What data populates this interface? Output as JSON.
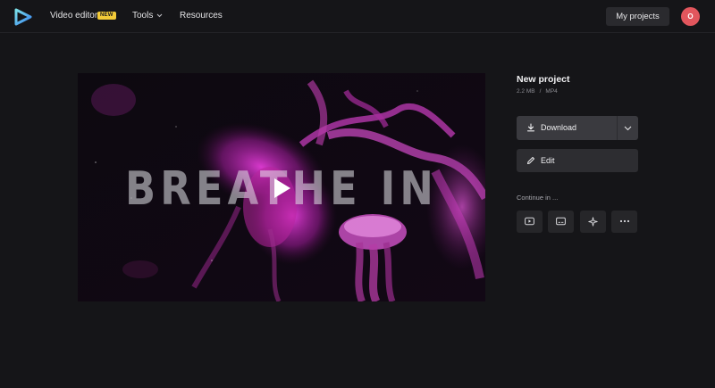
{
  "header": {
    "nav": {
      "video_editor": "Video editor",
      "video_editor_badge": "NEW",
      "tools": "Tools",
      "resources": "Resources"
    },
    "my_projects": "My projects",
    "avatar_initial": "O"
  },
  "video": {
    "overlay_text": "BREATHE IN"
  },
  "project": {
    "title": "New project",
    "size": "2.2 MB",
    "separator": "/",
    "format": "MP4",
    "download_label": "Download",
    "edit_label": "Edit",
    "continue_label": "Continue in ..."
  },
  "icons": {
    "continue_buttons": [
      "youtube-icon",
      "subtitles-icon",
      "magic-sparkle-icon",
      "more-icon"
    ]
  },
  "colors": {
    "background": "#151518",
    "badge": "#f3cb38",
    "avatar": "#e2565d",
    "button": "#3a3a3f",
    "logo_gradient_start": "#7be0e8",
    "logo_gradient_end": "#3a86f0"
  }
}
